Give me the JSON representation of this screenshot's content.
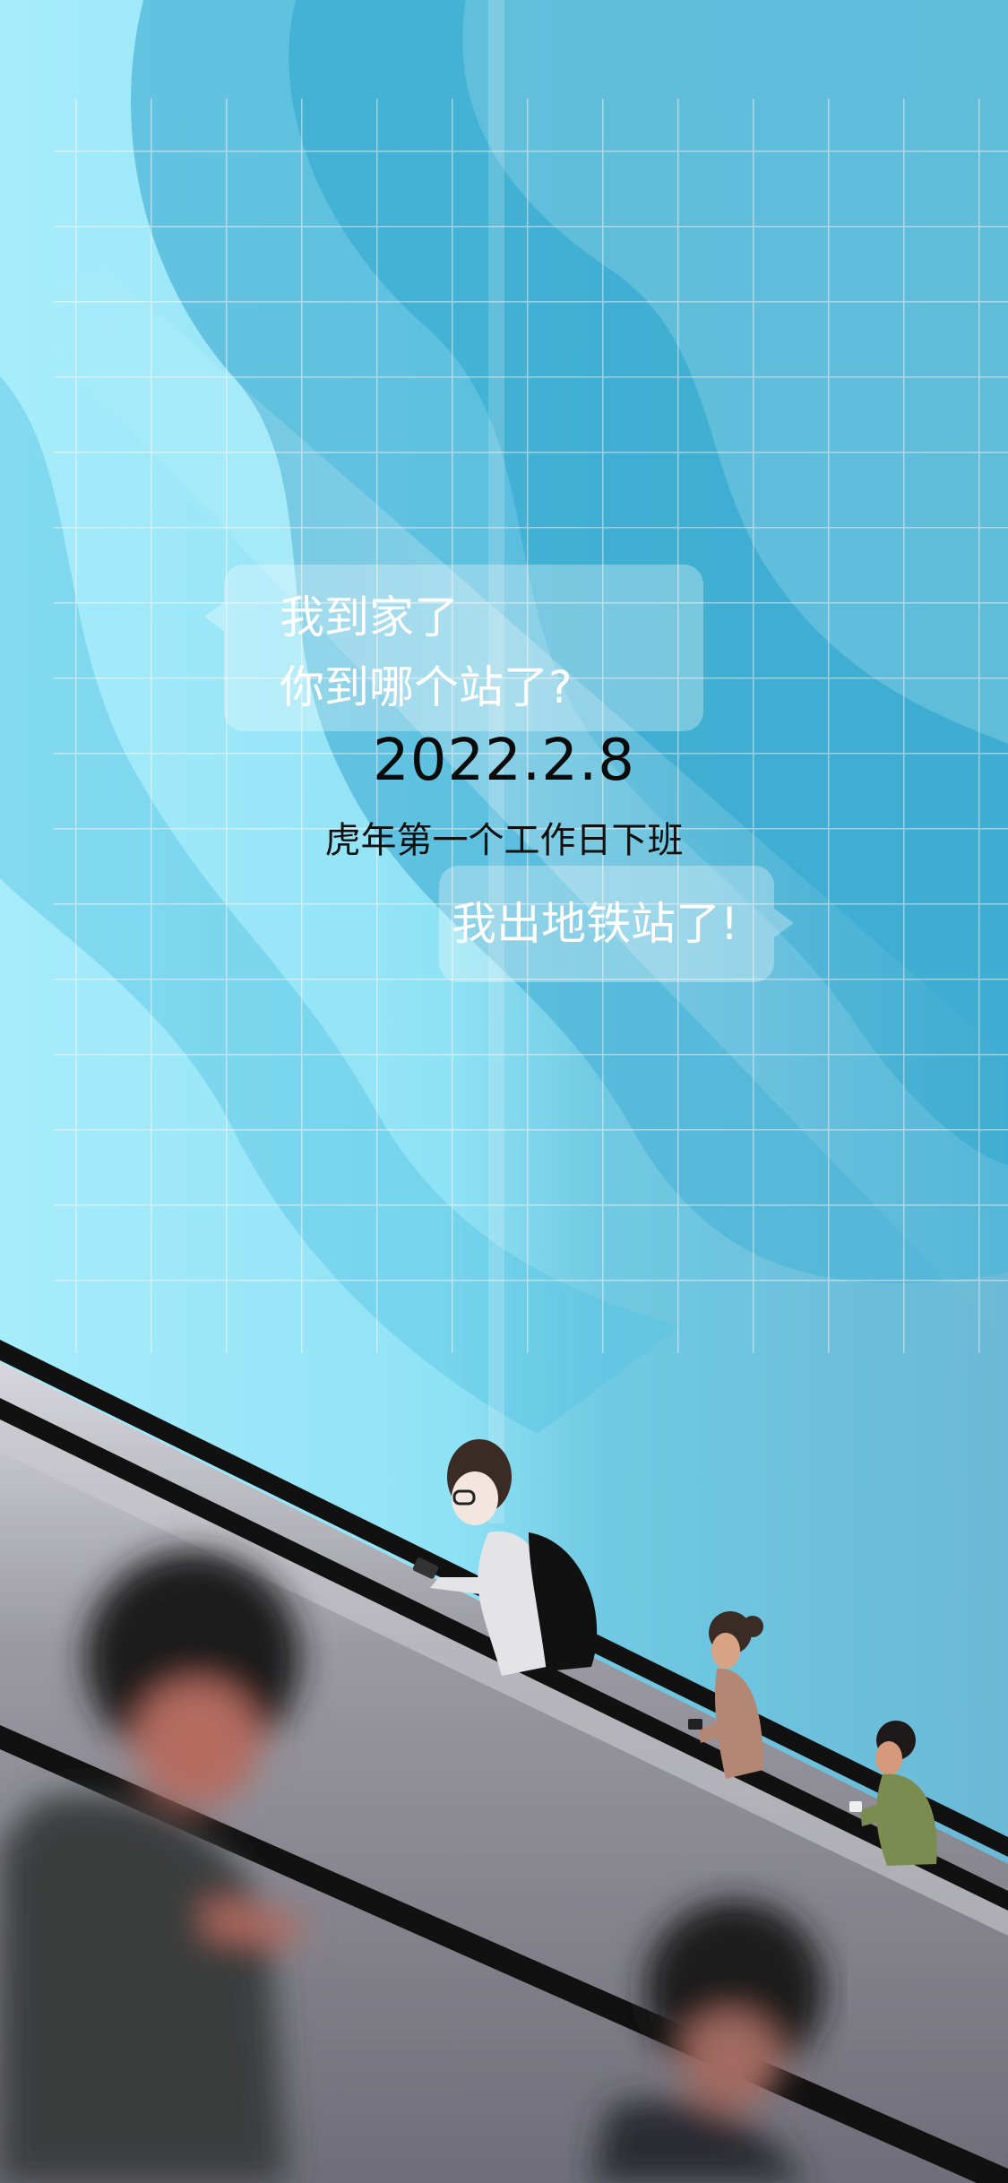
{
  "messages": {
    "received_line1": "我到家了",
    "received_line2": "你到哪个站了?",
    "sent": "我出地铁站了!"
  },
  "date": "2022.2.8",
  "caption": "虎年第一个工作日下班",
  "colors": {
    "sky_light": "#bff0fb",
    "sky_mid": "#6fd3ee",
    "sky_dark": "#2fa9cf",
    "escalator": "#8a8890"
  }
}
